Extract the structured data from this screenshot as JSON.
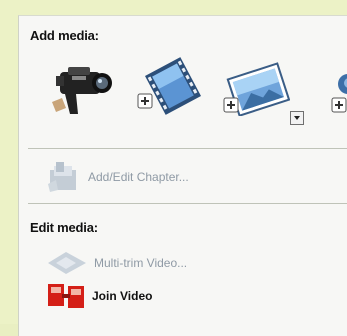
{
  "add_media": {
    "title": "Add media:",
    "buttons": [
      {
        "name": "capture-video-button",
        "icon": "video-camera-icon"
      },
      {
        "name": "add-video-button",
        "icon": "film-strip-icon"
      },
      {
        "name": "add-photo-button",
        "icon": "photo-icon"
      },
      {
        "name": "add-audio-button",
        "icon": "audio-icon"
      }
    ]
  },
  "chapter": {
    "label": "Add/Edit Chapter...",
    "icon": "chapter-icon",
    "enabled": false
  },
  "edit_media": {
    "title": "Edit media:",
    "items": [
      {
        "label": "Multi-trim Video...",
        "icon": "multi-trim-icon",
        "enabled": false
      },
      {
        "label": "Join Video",
        "icon": "join-video-icon",
        "enabled": true
      }
    ]
  },
  "colors": {
    "outer_background": "#ecf2c6",
    "panel_background": "#f7f7f5",
    "disabled_text": "#8f9aa5",
    "accent_red": "#d41f17"
  }
}
